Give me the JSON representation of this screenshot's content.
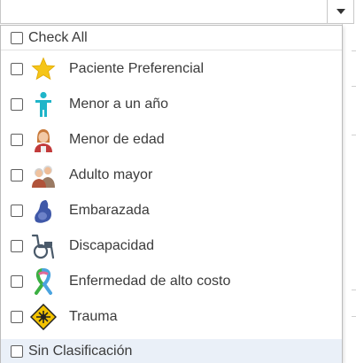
{
  "filter": {
    "check_all_label": "Check All",
    "items": [
      {
        "label": "Paciente Preferencial",
        "icon": "star-icon"
      },
      {
        "label": "Menor a un año",
        "icon": "child-icon"
      },
      {
        "label": "Menor de edad",
        "icon": "minor-person-icon"
      },
      {
        "label": "Adulto mayor",
        "icon": "elderly-people-icon"
      },
      {
        "label": "Embarazada",
        "icon": "pregnant-icon"
      },
      {
        "label": "Discapacidad",
        "icon": "wheelchair-icon"
      },
      {
        "label": "Enfermedad de alto costo",
        "icon": "awareness-ribbon-icon"
      },
      {
        "label": "Trauma",
        "icon": "trauma-warning-icon"
      }
    ],
    "sin_clasificacion_label": "Sin Clasificación"
  },
  "colors": {
    "star": "#f5c518",
    "child": "#1fb5c9",
    "selected_row_bg": "#eaf0f8"
  }
}
